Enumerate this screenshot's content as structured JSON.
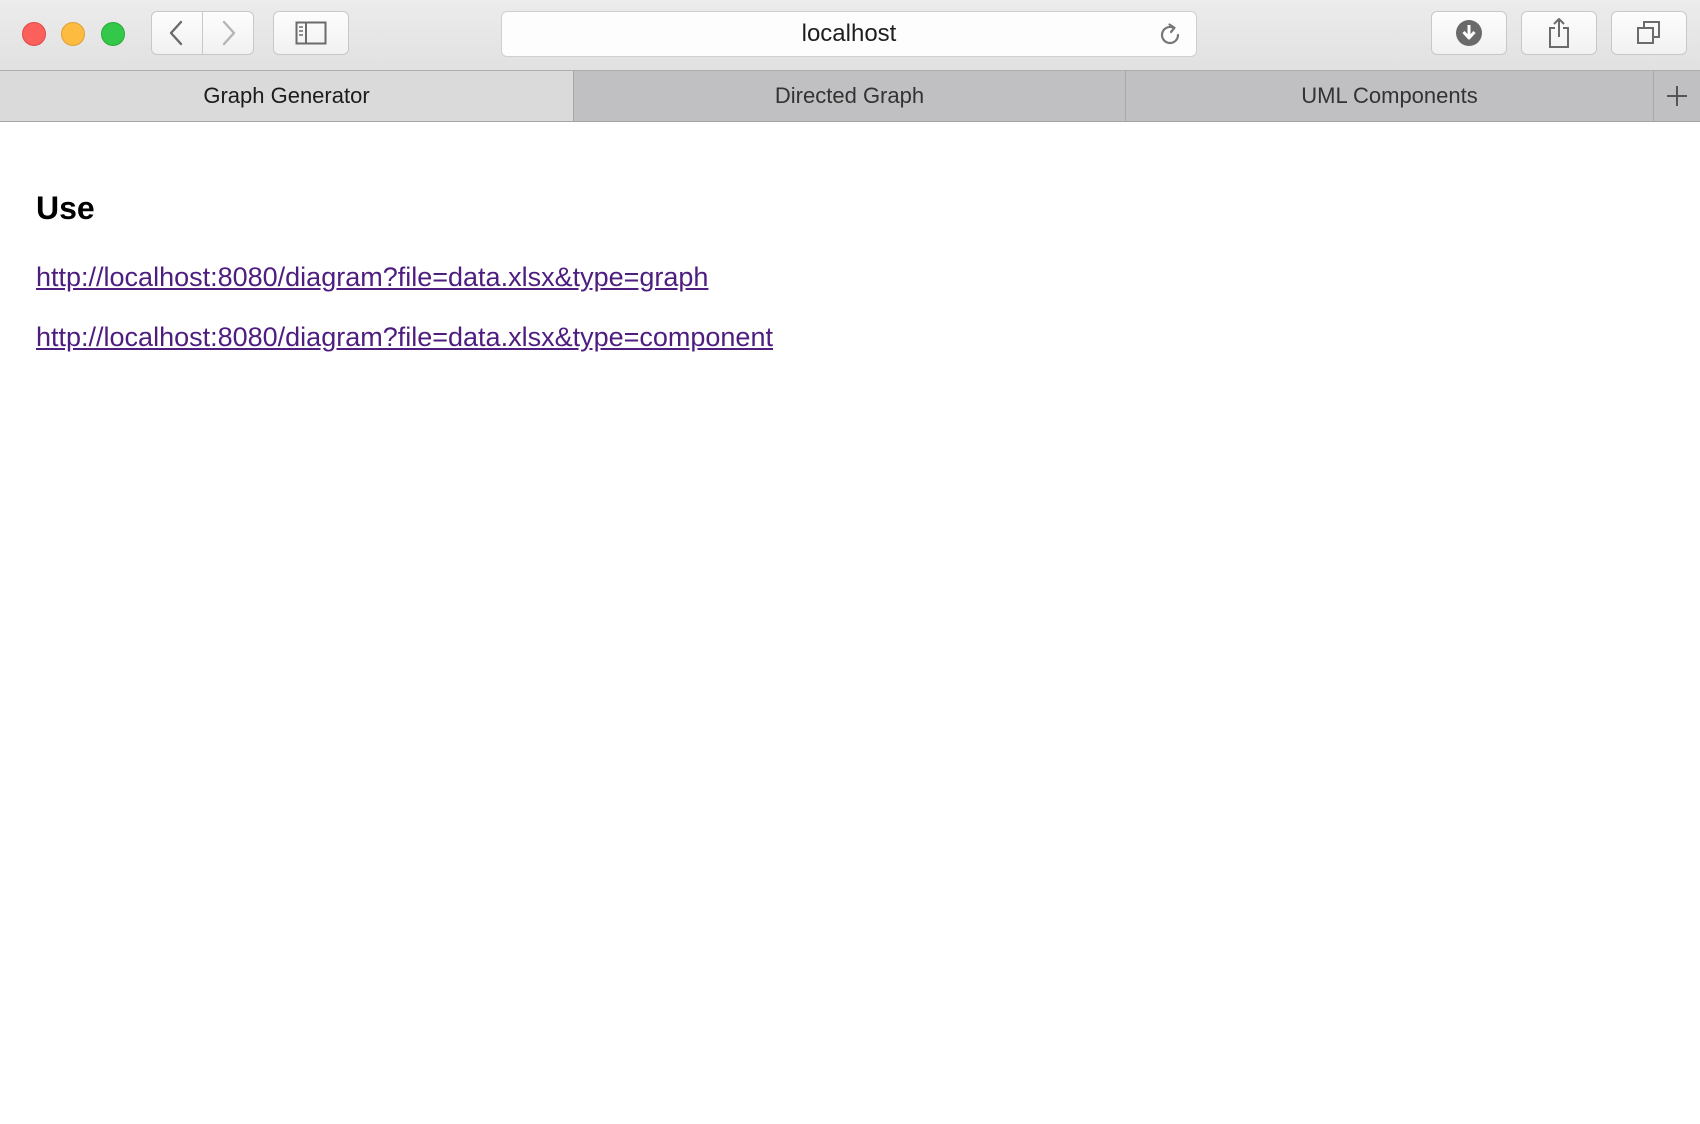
{
  "browser": {
    "address_bar": {
      "url": "localhost"
    },
    "toolbar_icons": [
      "close",
      "minimize",
      "maximize",
      "back-icon",
      "forward-icon",
      "sidebar-icon",
      "reload-icon",
      "download-icon",
      "share-icon",
      "tabs-overview-icon"
    ]
  },
  "tabs": [
    {
      "label": "Graph Generator",
      "active": true
    },
    {
      "label": "Directed Graph",
      "active": false
    },
    {
      "label": "UML Components",
      "active": false
    }
  ],
  "page": {
    "heading": "Use",
    "links": [
      "http://localhost:8080/diagram?file=data.xlsx&type=graph",
      "http://localhost:8080/diagram?file=data.xlsx&type=component"
    ]
  },
  "colors": {
    "visited_link": "#4d1d7f",
    "close": "#fc605c",
    "minimize": "#fdbc40",
    "maximize": "#34c84a"
  }
}
